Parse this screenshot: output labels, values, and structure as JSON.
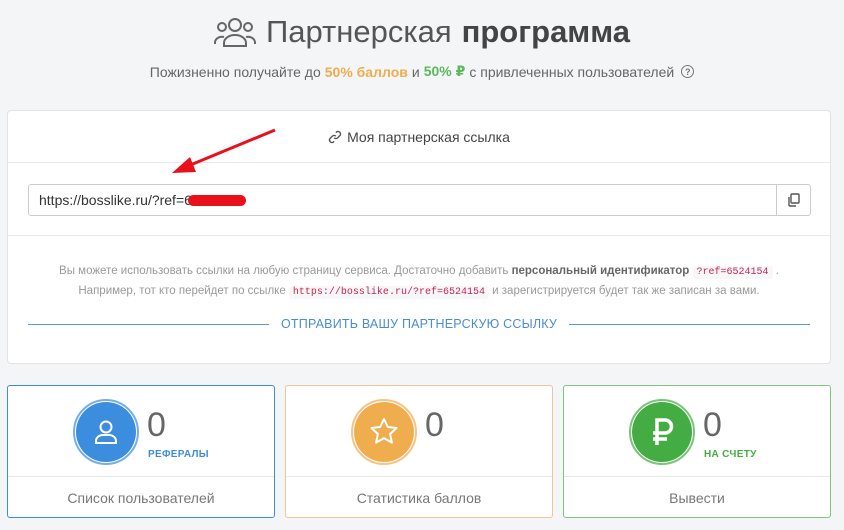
{
  "header": {
    "title_light": "Партнерская",
    "title_bold": "программа",
    "subtitle_before": "Пожизненно получайте до",
    "subtitle_points": "50% баллов",
    "subtitle_and": "и",
    "subtitle_rub": "50% ₽",
    "subtitle_after": "с привлеченных пользователей",
    "help_glyph": "?"
  },
  "link_card": {
    "heading": "Моя партнерская ссылка",
    "link_value": "https://bosslike.ru/?ref=652",
    "desc_1a": "Вы можете использовать ссылки на любую страницу сервиса. Достаточно добавить",
    "desc_1b": "персональный идентификатор",
    "desc_1c": "?ref=6524154",
    "desc_2a": "Например, тот кто перейдет по ссылке",
    "desc_2b": "https://bosslike.ru/?ref=6524154",
    "desc_2c": "и зарегистрируется будет так же записан за вами.",
    "send_link": "ОТПРАВИТЬ ВАШУ ПАРТНЕРСКУЮ ССЫЛКУ"
  },
  "stats": [
    {
      "value": "0",
      "label": "РЕФЕРАЛЫ",
      "action": "Список пользователей",
      "icon": "user-icon"
    },
    {
      "value": "0",
      "label": "",
      "action": "Статистика баллов",
      "icon": "star-icon"
    },
    {
      "value": "0",
      "label": "НА СЧЕТУ",
      "action": "Вывести",
      "icon": "ruble-icon"
    }
  ],
  "colors": {
    "blue": "#3c8dde",
    "orange": "#f0ad4e",
    "green": "#43ad43",
    "arrow": "#e8101a"
  }
}
